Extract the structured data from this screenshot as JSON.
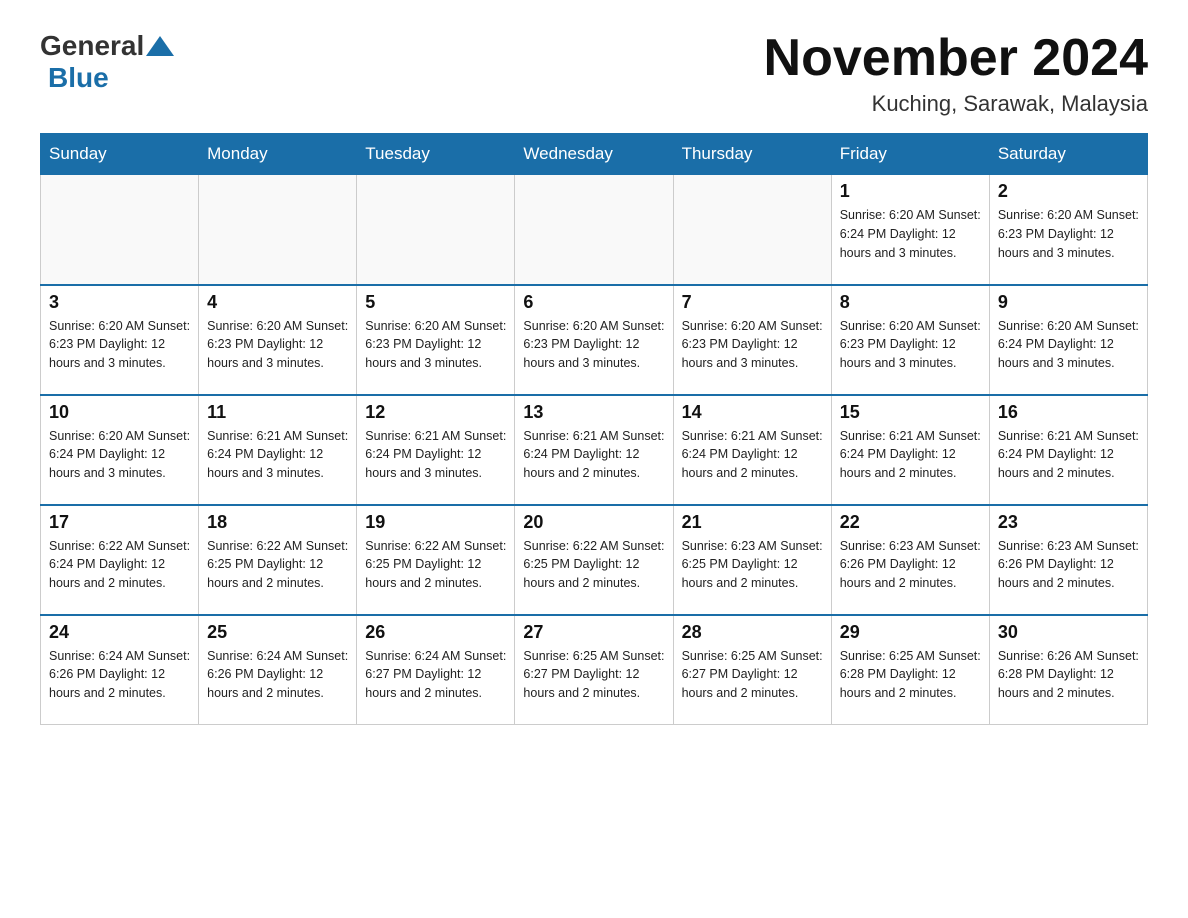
{
  "header": {
    "logo_general": "General",
    "logo_blue": "Blue",
    "month_title": "November 2024",
    "location": "Kuching, Sarawak, Malaysia"
  },
  "days_of_week": [
    "Sunday",
    "Monday",
    "Tuesday",
    "Wednesday",
    "Thursday",
    "Friday",
    "Saturday"
  ],
  "weeks": [
    [
      {
        "day": "",
        "info": ""
      },
      {
        "day": "",
        "info": ""
      },
      {
        "day": "",
        "info": ""
      },
      {
        "day": "",
        "info": ""
      },
      {
        "day": "",
        "info": ""
      },
      {
        "day": "1",
        "info": "Sunrise: 6:20 AM\nSunset: 6:24 PM\nDaylight: 12 hours\nand 3 minutes."
      },
      {
        "day": "2",
        "info": "Sunrise: 6:20 AM\nSunset: 6:23 PM\nDaylight: 12 hours\nand 3 minutes."
      }
    ],
    [
      {
        "day": "3",
        "info": "Sunrise: 6:20 AM\nSunset: 6:23 PM\nDaylight: 12 hours\nand 3 minutes."
      },
      {
        "day": "4",
        "info": "Sunrise: 6:20 AM\nSunset: 6:23 PM\nDaylight: 12 hours\nand 3 minutes."
      },
      {
        "day": "5",
        "info": "Sunrise: 6:20 AM\nSunset: 6:23 PM\nDaylight: 12 hours\nand 3 minutes."
      },
      {
        "day": "6",
        "info": "Sunrise: 6:20 AM\nSunset: 6:23 PM\nDaylight: 12 hours\nand 3 minutes."
      },
      {
        "day": "7",
        "info": "Sunrise: 6:20 AM\nSunset: 6:23 PM\nDaylight: 12 hours\nand 3 minutes."
      },
      {
        "day": "8",
        "info": "Sunrise: 6:20 AM\nSunset: 6:23 PM\nDaylight: 12 hours\nand 3 minutes."
      },
      {
        "day": "9",
        "info": "Sunrise: 6:20 AM\nSunset: 6:24 PM\nDaylight: 12 hours\nand 3 minutes."
      }
    ],
    [
      {
        "day": "10",
        "info": "Sunrise: 6:20 AM\nSunset: 6:24 PM\nDaylight: 12 hours\nand 3 minutes."
      },
      {
        "day": "11",
        "info": "Sunrise: 6:21 AM\nSunset: 6:24 PM\nDaylight: 12 hours\nand 3 minutes."
      },
      {
        "day": "12",
        "info": "Sunrise: 6:21 AM\nSunset: 6:24 PM\nDaylight: 12 hours\nand 3 minutes."
      },
      {
        "day": "13",
        "info": "Sunrise: 6:21 AM\nSunset: 6:24 PM\nDaylight: 12 hours\nand 2 minutes."
      },
      {
        "day": "14",
        "info": "Sunrise: 6:21 AM\nSunset: 6:24 PM\nDaylight: 12 hours\nand 2 minutes."
      },
      {
        "day": "15",
        "info": "Sunrise: 6:21 AM\nSunset: 6:24 PM\nDaylight: 12 hours\nand 2 minutes."
      },
      {
        "day": "16",
        "info": "Sunrise: 6:21 AM\nSunset: 6:24 PM\nDaylight: 12 hours\nand 2 minutes."
      }
    ],
    [
      {
        "day": "17",
        "info": "Sunrise: 6:22 AM\nSunset: 6:24 PM\nDaylight: 12 hours\nand 2 minutes."
      },
      {
        "day": "18",
        "info": "Sunrise: 6:22 AM\nSunset: 6:25 PM\nDaylight: 12 hours\nand 2 minutes."
      },
      {
        "day": "19",
        "info": "Sunrise: 6:22 AM\nSunset: 6:25 PM\nDaylight: 12 hours\nand 2 minutes."
      },
      {
        "day": "20",
        "info": "Sunrise: 6:22 AM\nSunset: 6:25 PM\nDaylight: 12 hours\nand 2 minutes."
      },
      {
        "day": "21",
        "info": "Sunrise: 6:23 AM\nSunset: 6:25 PM\nDaylight: 12 hours\nand 2 minutes."
      },
      {
        "day": "22",
        "info": "Sunrise: 6:23 AM\nSunset: 6:26 PM\nDaylight: 12 hours\nand 2 minutes."
      },
      {
        "day": "23",
        "info": "Sunrise: 6:23 AM\nSunset: 6:26 PM\nDaylight: 12 hours\nand 2 minutes."
      }
    ],
    [
      {
        "day": "24",
        "info": "Sunrise: 6:24 AM\nSunset: 6:26 PM\nDaylight: 12 hours\nand 2 minutes."
      },
      {
        "day": "25",
        "info": "Sunrise: 6:24 AM\nSunset: 6:26 PM\nDaylight: 12 hours\nand 2 minutes."
      },
      {
        "day": "26",
        "info": "Sunrise: 6:24 AM\nSunset: 6:27 PM\nDaylight: 12 hours\nand 2 minutes."
      },
      {
        "day": "27",
        "info": "Sunrise: 6:25 AM\nSunset: 6:27 PM\nDaylight: 12 hours\nand 2 minutes."
      },
      {
        "day": "28",
        "info": "Sunrise: 6:25 AM\nSunset: 6:27 PM\nDaylight: 12 hours\nand 2 minutes."
      },
      {
        "day": "29",
        "info": "Sunrise: 6:25 AM\nSunset: 6:28 PM\nDaylight: 12 hours\nand 2 minutes."
      },
      {
        "day": "30",
        "info": "Sunrise: 6:26 AM\nSunset: 6:28 PM\nDaylight: 12 hours\nand 2 minutes."
      }
    ]
  ]
}
